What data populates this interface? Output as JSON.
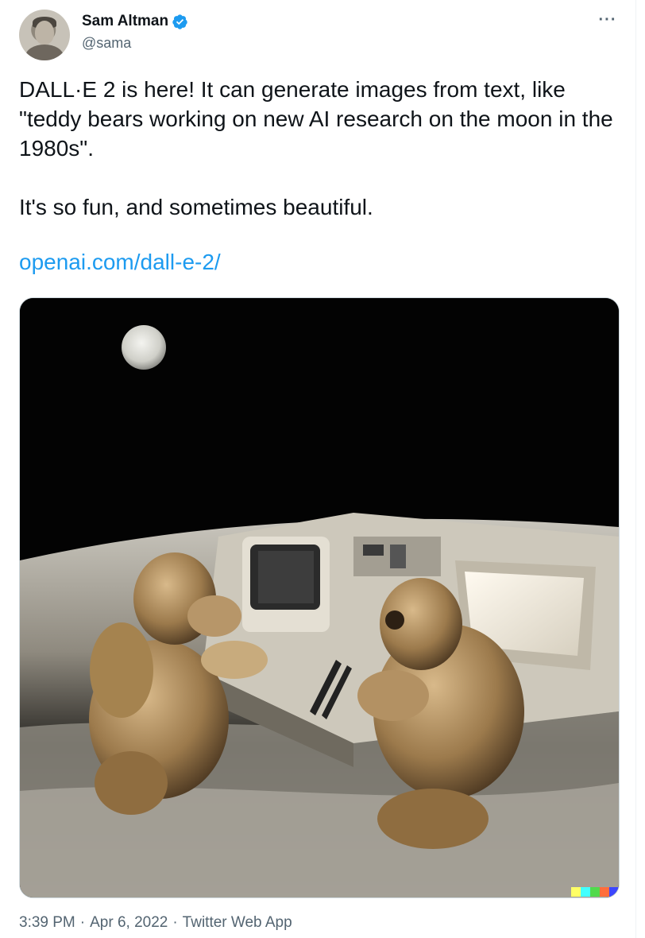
{
  "author": {
    "name": "Sam Altman",
    "handle": "@sama",
    "verified": true,
    "avatar_icon": "profile-photo"
  },
  "more_icon": "more-horizontal-icon",
  "tweet": {
    "line1": "DALL·E 2 is here! It can generate images from text, like \"teddy bears working on new AI research on the moon in the 1980s\".",
    "line2": "It's so fun, and sometimes beautiful.",
    "link_text": "openai.com/dall-e-2/"
  },
  "meta": {
    "time": "3:39 PM",
    "sep1": "·",
    "date": "Apr 6, 2022",
    "sep2": "·",
    "source": "Twitter Web App"
  },
  "colors": {
    "accent": "#1d9bf0",
    "text": "#0f1419",
    "secondary": "#536471"
  }
}
